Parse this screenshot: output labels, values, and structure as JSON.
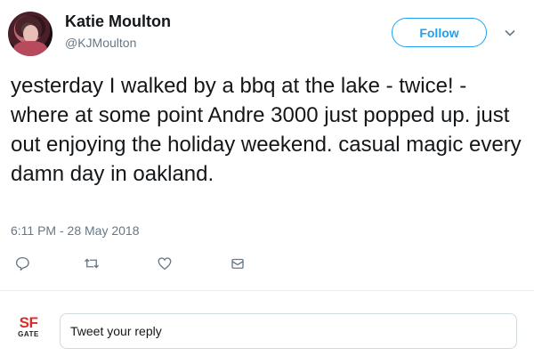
{
  "author": {
    "name": "Katie Moulton",
    "handle": "@KJMoulton"
  },
  "follow_label": "Follow",
  "tweet": {
    "text": "yesterday I walked by a bbq at the lake - twice! - where at some point Andre 3000 just popped up. just out enjoying the holiday weekend. casual magic every damn day in oakland.",
    "timestamp": "6:11 PM - 28 May 2018"
  },
  "actions": {
    "reply_icon": "reply-icon",
    "retweet_icon": "retweet-icon",
    "like_icon": "heart-icon",
    "dm_icon": "envelope-icon"
  },
  "reply": {
    "logo_top": "SF",
    "logo_bottom": "GATE",
    "placeholder": "Tweet your reply"
  },
  "colors": {
    "accent": "#1da1f2",
    "secondary_text": "#657786",
    "logo_red": "#d92b2b"
  }
}
